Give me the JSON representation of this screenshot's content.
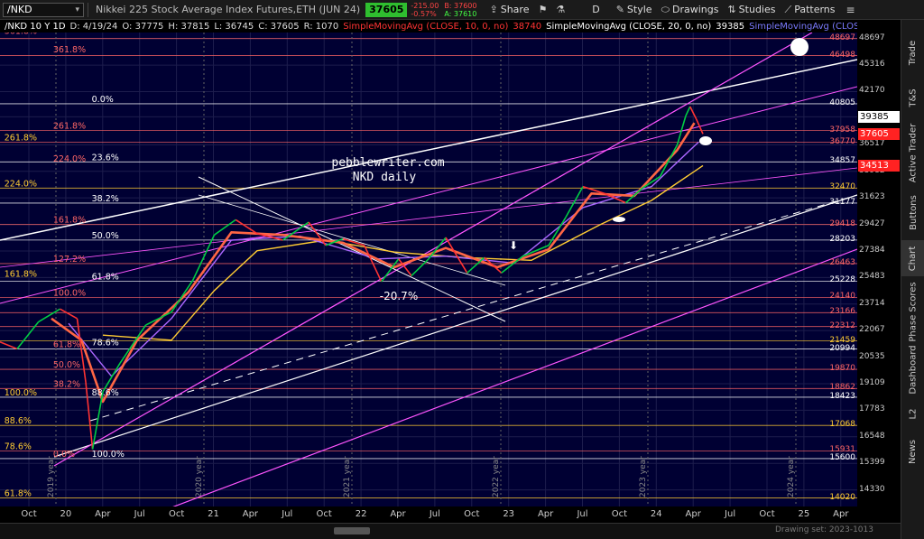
{
  "toolbar": {
    "symbol": "/NKD",
    "description": "Nikkei 225 Stock Average Index Futures,ETH (JUN 24)",
    "last": "37605",
    "change": "-215.00",
    "change_pct": "-0.57%",
    "bid": "B: 37600",
    "ask": "A: 37610",
    "share": "Share",
    "d_label": "D",
    "style": "Style",
    "drawings": "Drawings",
    "studies": "Studies",
    "patterns": "Patterns"
  },
  "studybar": {
    "name": "/NKD 10 Y 1D",
    "date": "D: 4/19/24",
    "open": "O: 37775",
    "high": "H: 37815",
    "low": "L: 36745",
    "close": "C: 37605",
    "range": "R: 1070",
    "sma10_label": "SimpleMovingAvg (CLOSE, 10, 0, no)",
    "sma10_value": "38740",
    "sma20_label": "SimpleMovingAvg (CLOSE, 20, 0, no)",
    "sma20_value": "39385",
    "sma50_label": "SimpleMovingAvg (CLOSE, 50, 0, no)",
    "sma10_color": "#ff3333",
    "sma20_color": "#ffffff",
    "sma50_color": "#7b7bff"
  },
  "side_tabs": [
    "Trade",
    "T&S",
    "Active Trader",
    "Buttons",
    "Chart",
    "Phase Scores",
    "Dashboard",
    "L2",
    "News"
  ],
  "bottom": {
    "drawing_set": "Drawing set: 2023-1013"
  },
  "colors": {
    "background": "#000033",
    "up": "#00cc44",
    "down": "#ff3333",
    "channel": "#ff55ff",
    "sma10": "#ff6644",
    "sma20": "#aa66ff",
    "sma50": "#ffcc33"
  },
  "chart_data": {
    "type": "line",
    "title": "pebblewriter.com",
    "subtitle": "NKD daily",
    "annotation": "-20.7%",
    "x_ticks": [
      "Oct",
      "20",
      "Apr",
      "Jul",
      "Oct",
      "21",
      "Apr",
      "Jul",
      "Oct",
      "22",
      "Apr",
      "Jul",
      "Oct",
      "23",
      "Apr",
      "Jul",
      "Oct",
      "24",
      "Apr",
      "Jul",
      "Oct",
      "25",
      "Apr"
    ],
    "year_labels": [
      "2019 year",
      "2020 year",
      "2021 year",
      "2022 year",
      "2023 year",
      "2024 year"
    ],
    "y_ticks": [
      48697,
      45316,
      42170,
      39385,
      36517,
      33982,
      31623,
      29427,
      27384,
      25483,
      23714,
      22067,
      20535,
      19109,
      17783,
      16548,
      15399,
      14330
    ],
    "ylim": [
      13700,
      49500
    ],
    "price_axis_markers": [
      {
        "value": 48697,
        "label": "48697",
        "color": "#ff6666"
      },
      {
        "value": 46498,
        "label": "46498",
        "color": "#ff6666"
      },
      {
        "value": 40805,
        "label": "40805",
        "color": "#ffffff"
      },
      {
        "value": 37958,
        "label": "37958",
        "color": "#ff6666"
      },
      {
        "value": 36770,
        "label": "36770",
        "color": "#ff6666"
      },
      {
        "value": 34857,
        "label": "34857",
        "color": "#ffffff"
      },
      {
        "value": 32470,
        "label": "32470",
        "color": "#ffcc33"
      },
      {
        "value": 31177,
        "label": "31177",
        "color": "#ffffff"
      },
      {
        "value": 29418,
        "label": "29418",
        "color": "#ff6666"
      },
      {
        "value": 28203,
        "label": "28203",
        "color": "#ffffff"
      },
      {
        "value": 26463,
        "label": "26463",
        "color": "#ff6666"
      },
      {
        "value": 25228,
        "label": "25228",
        "color": "#ffffff"
      },
      {
        "value": 24140,
        "label": "24140",
        "color": "#ff6666"
      },
      {
        "value": 23166,
        "label": "23166",
        "color": "#ff6666"
      },
      {
        "value": 22312,
        "label": "22312",
        "color": "#ff6666"
      },
      {
        "value": 21459,
        "label": "21459",
        "color": "#ffcc33"
      },
      {
        "value": 20994,
        "label": "20994",
        "color": "#ffffff"
      },
      {
        "value": 19870,
        "label": "19870",
        "color": "#ff6666"
      },
      {
        "value": 18862,
        "label": "18862",
        "color": "#ff6666"
      },
      {
        "value": 18423,
        "label": "18423",
        "color": "#ffffff"
      },
      {
        "value": 17068,
        "label": "17068",
        "color": "#ffcc33"
      },
      {
        "value": 15931,
        "label": "15931",
        "color": "#ff6666"
      },
      {
        "value": 15600,
        "label": "15600",
        "color": "#ffffff"
      },
      {
        "value": 14020,
        "label": "14020",
        "color": "#ffcc33"
      }
    ],
    "price_boxes": [
      {
        "value": 39385,
        "label": "39385",
        "bg": "#ffffff",
        "fg": "#000000"
      },
      {
        "value": 37605,
        "label": "37605",
        "bg": "#ff2222",
        "fg": "#ffffff"
      },
      {
        "value": 34513,
        "label": "34513",
        "bg": "#ff2222",
        "fg": "#ffffff"
      }
    ],
    "fib_labels": [
      {
        "text": "361.8%",
        "value": 49100,
        "x_frac": 0.005,
        "color": "#ff6666"
      },
      {
        "text": "361.8%",
        "value": 46700,
        "x_frac": 0.062,
        "color": "#ff6666"
      },
      {
        "text": "0.0%",
        "value": 40805,
        "x_frac": 0.107,
        "color": "#ffffff"
      },
      {
        "text": "261.8%",
        "value": 37958,
        "x_frac": 0.062,
        "color": "#ff6666"
      },
      {
        "text": "261.8%",
        "value": 36770,
        "x_frac": 0.005,
        "color": "#ffcc33"
      },
      {
        "text": "23.6%",
        "value": 34857,
        "x_frac": 0.107,
        "color": "#ffffff"
      },
      {
        "text": "224.0%",
        "value": 34700,
        "x_frac": 0.062,
        "color": "#ff6666"
      },
      {
        "text": "224.0%",
        "value": 32470,
        "x_frac": 0.005,
        "color": "#ffcc33"
      },
      {
        "text": "38.2%",
        "value": 31177,
        "x_frac": 0.107,
        "color": "#ffffff"
      },
      {
        "text": "161.8%",
        "value": 29418,
        "x_frac": 0.062,
        "color": "#ff6666"
      },
      {
        "text": "50.0%",
        "value": 28203,
        "x_frac": 0.107,
        "color": "#ffffff"
      },
      {
        "text": "127.2%",
        "value": 26463,
        "x_frac": 0.062,
        "color": "#ff6666"
      },
      {
        "text": "161.8%",
        "value": 25400,
        "x_frac": 0.005,
        "color": "#ffcc33"
      },
      {
        "text": "61.8%",
        "value": 25228,
        "x_frac": 0.107,
        "color": "#ffffff"
      },
      {
        "text": "100.0%",
        "value": 24140,
        "x_frac": 0.062,
        "color": "#ff6666"
      },
      {
        "text": "61.8%",
        "value": 20994,
        "x_frac": 0.062,
        "color": "#ff6666"
      },
      {
        "text": "78.6%",
        "value": 21100,
        "x_frac": 0.107,
        "color": "#ffffff"
      },
      {
        "text": "50.0%",
        "value": 19870,
        "x_frac": 0.062,
        "color": "#ff6666"
      },
      {
        "text": "38.2%",
        "value": 18862,
        "x_frac": 0.062,
        "color": "#ff6666"
      },
      {
        "text": "100.0%",
        "value": 18423,
        "x_frac": 0.005,
        "color": "#ffcc33"
      },
      {
        "text": "88.6%",
        "value": 18423,
        "x_frac": 0.107,
        "color": "#ffffff"
      },
      {
        "text": "88.6%",
        "value": 17068,
        "x_frac": 0.005,
        "color": "#ffcc33"
      },
      {
        "text": "78.6%",
        "value": 15931,
        "x_frac": 0.005,
        "color": "#ffcc33"
      },
      {
        "text": "0.0%",
        "value": 15600,
        "x_frac": 0.062,
        "color": "#ff6666"
      },
      {
        "text": "100.0%",
        "value": 15600,
        "x_frac": 0.107,
        "color": "#ffffff"
      },
      {
        "text": "61.8%",
        "value": 14020,
        "x_frac": 0.005,
        "color": "#ffcc33"
      }
    ],
    "price_series": [
      {
        "t": 0.0,
        "v": 21400
      },
      {
        "t": 0.02,
        "v": 21000
      },
      {
        "t": 0.045,
        "v": 22600
      },
      {
        "t": 0.07,
        "v": 23400
      },
      {
        "t": 0.09,
        "v": 22800
      },
      {
        "t": 0.1,
        "v": 19200
      },
      {
        "t": 0.108,
        "v": 16000
      },
      {
        "t": 0.12,
        "v": 18700
      },
      {
        "t": 0.14,
        "v": 20200
      },
      {
        "t": 0.17,
        "v": 22400
      },
      {
        "t": 0.2,
        "v": 23200
      },
      {
        "t": 0.225,
        "v": 25300
      },
      {
        "t": 0.25,
        "v": 28600
      },
      {
        "t": 0.275,
        "v": 29800
      },
      {
        "t": 0.3,
        "v": 28700
      },
      {
        "t": 0.33,
        "v": 28200
      },
      {
        "t": 0.36,
        "v": 29600
      },
      {
        "t": 0.38,
        "v": 27800
      },
      {
        "t": 0.4,
        "v": 28300
      },
      {
        "t": 0.425,
        "v": 27800
      },
      {
        "t": 0.445,
        "v": 25200
      },
      {
        "t": 0.465,
        "v": 26800
      },
      {
        "t": 0.48,
        "v": 25600
      },
      {
        "t": 0.5,
        "v": 26800
      },
      {
        "t": 0.52,
        "v": 28400
      },
      {
        "t": 0.545,
        "v": 25800
      },
      {
        "t": 0.565,
        "v": 26900
      },
      {
        "t": 0.585,
        "v": 25800
      },
      {
        "t": 0.61,
        "v": 27000
      },
      {
        "t": 0.64,
        "v": 27800
      },
      {
        "t": 0.66,
        "v": 30000
      },
      {
        "t": 0.68,
        "v": 32600
      },
      {
        "t": 0.705,
        "v": 32000
      },
      {
        "t": 0.73,
        "v": 31200
      },
      {
        "t": 0.75,
        "v": 32500
      },
      {
        "t": 0.77,
        "v": 33500
      },
      {
        "t": 0.79,
        "v": 36500
      },
      {
        "t": 0.8,
        "v": 39500
      },
      {
        "t": 0.805,
        "v": 40500
      },
      {
        "t": 0.812,
        "v": 39200
      },
      {
        "t": 0.82,
        "v": 37605
      }
    ],
    "sma10": [
      {
        "t": 0.06,
        "v": 22800
      },
      {
        "t": 0.095,
        "v": 21500
      },
      {
        "t": 0.12,
        "v": 18200
      },
      {
        "t": 0.16,
        "v": 21500
      },
      {
        "t": 0.22,
        "v": 24500
      },
      {
        "t": 0.27,
        "v": 28800
      },
      {
        "t": 0.33,
        "v": 28600
      },
      {
        "t": 0.4,
        "v": 28000
      },
      {
        "t": 0.46,
        "v": 26200
      },
      {
        "t": 0.52,
        "v": 27600
      },
      {
        "t": 0.58,
        "v": 26200
      },
      {
        "t": 0.64,
        "v": 27500
      },
      {
        "t": 0.69,
        "v": 32000
      },
      {
        "t": 0.74,
        "v": 31800
      },
      {
        "t": 0.79,
        "v": 36000
      },
      {
        "t": 0.81,
        "v": 38740
      }
    ],
    "sma20": [
      {
        "t": 0.08,
        "v": 22500
      },
      {
        "t": 0.13,
        "v": 19500
      },
      {
        "t": 0.2,
        "v": 22800
      },
      {
        "t": 0.27,
        "v": 28200
      },
      {
        "t": 0.35,
        "v": 28500
      },
      {
        "t": 0.44,
        "v": 26800
      },
      {
        "t": 0.52,
        "v": 27000
      },
      {
        "t": 0.6,
        "v": 26500
      },
      {
        "t": 0.68,
        "v": 30800
      },
      {
        "t": 0.76,
        "v": 32600
      },
      {
        "t": 0.815,
        "v": 36800
      }
    ],
    "sma50": [
      {
        "t": 0.12,
        "v": 21800
      },
      {
        "t": 0.2,
        "v": 21500
      },
      {
        "t": 0.25,
        "v": 24600
      },
      {
        "t": 0.3,
        "v": 27400
      },
      {
        "t": 0.38,
        "v": 28200
      },
      {
        "t": 0.46,
        "v": 27300
      },
      {
        "t": 0.54,
        "v": 26900
      },
      {
        "t": 0.62,
        "v": 26700
      },
      {
        "t": 0.7,
        "v": 29400
      },
      {
        "t": 0.76,
        "v": 31400
      },
      {
        "t": 0.82,
        "v": 34513
      }
    ]
  }
}
